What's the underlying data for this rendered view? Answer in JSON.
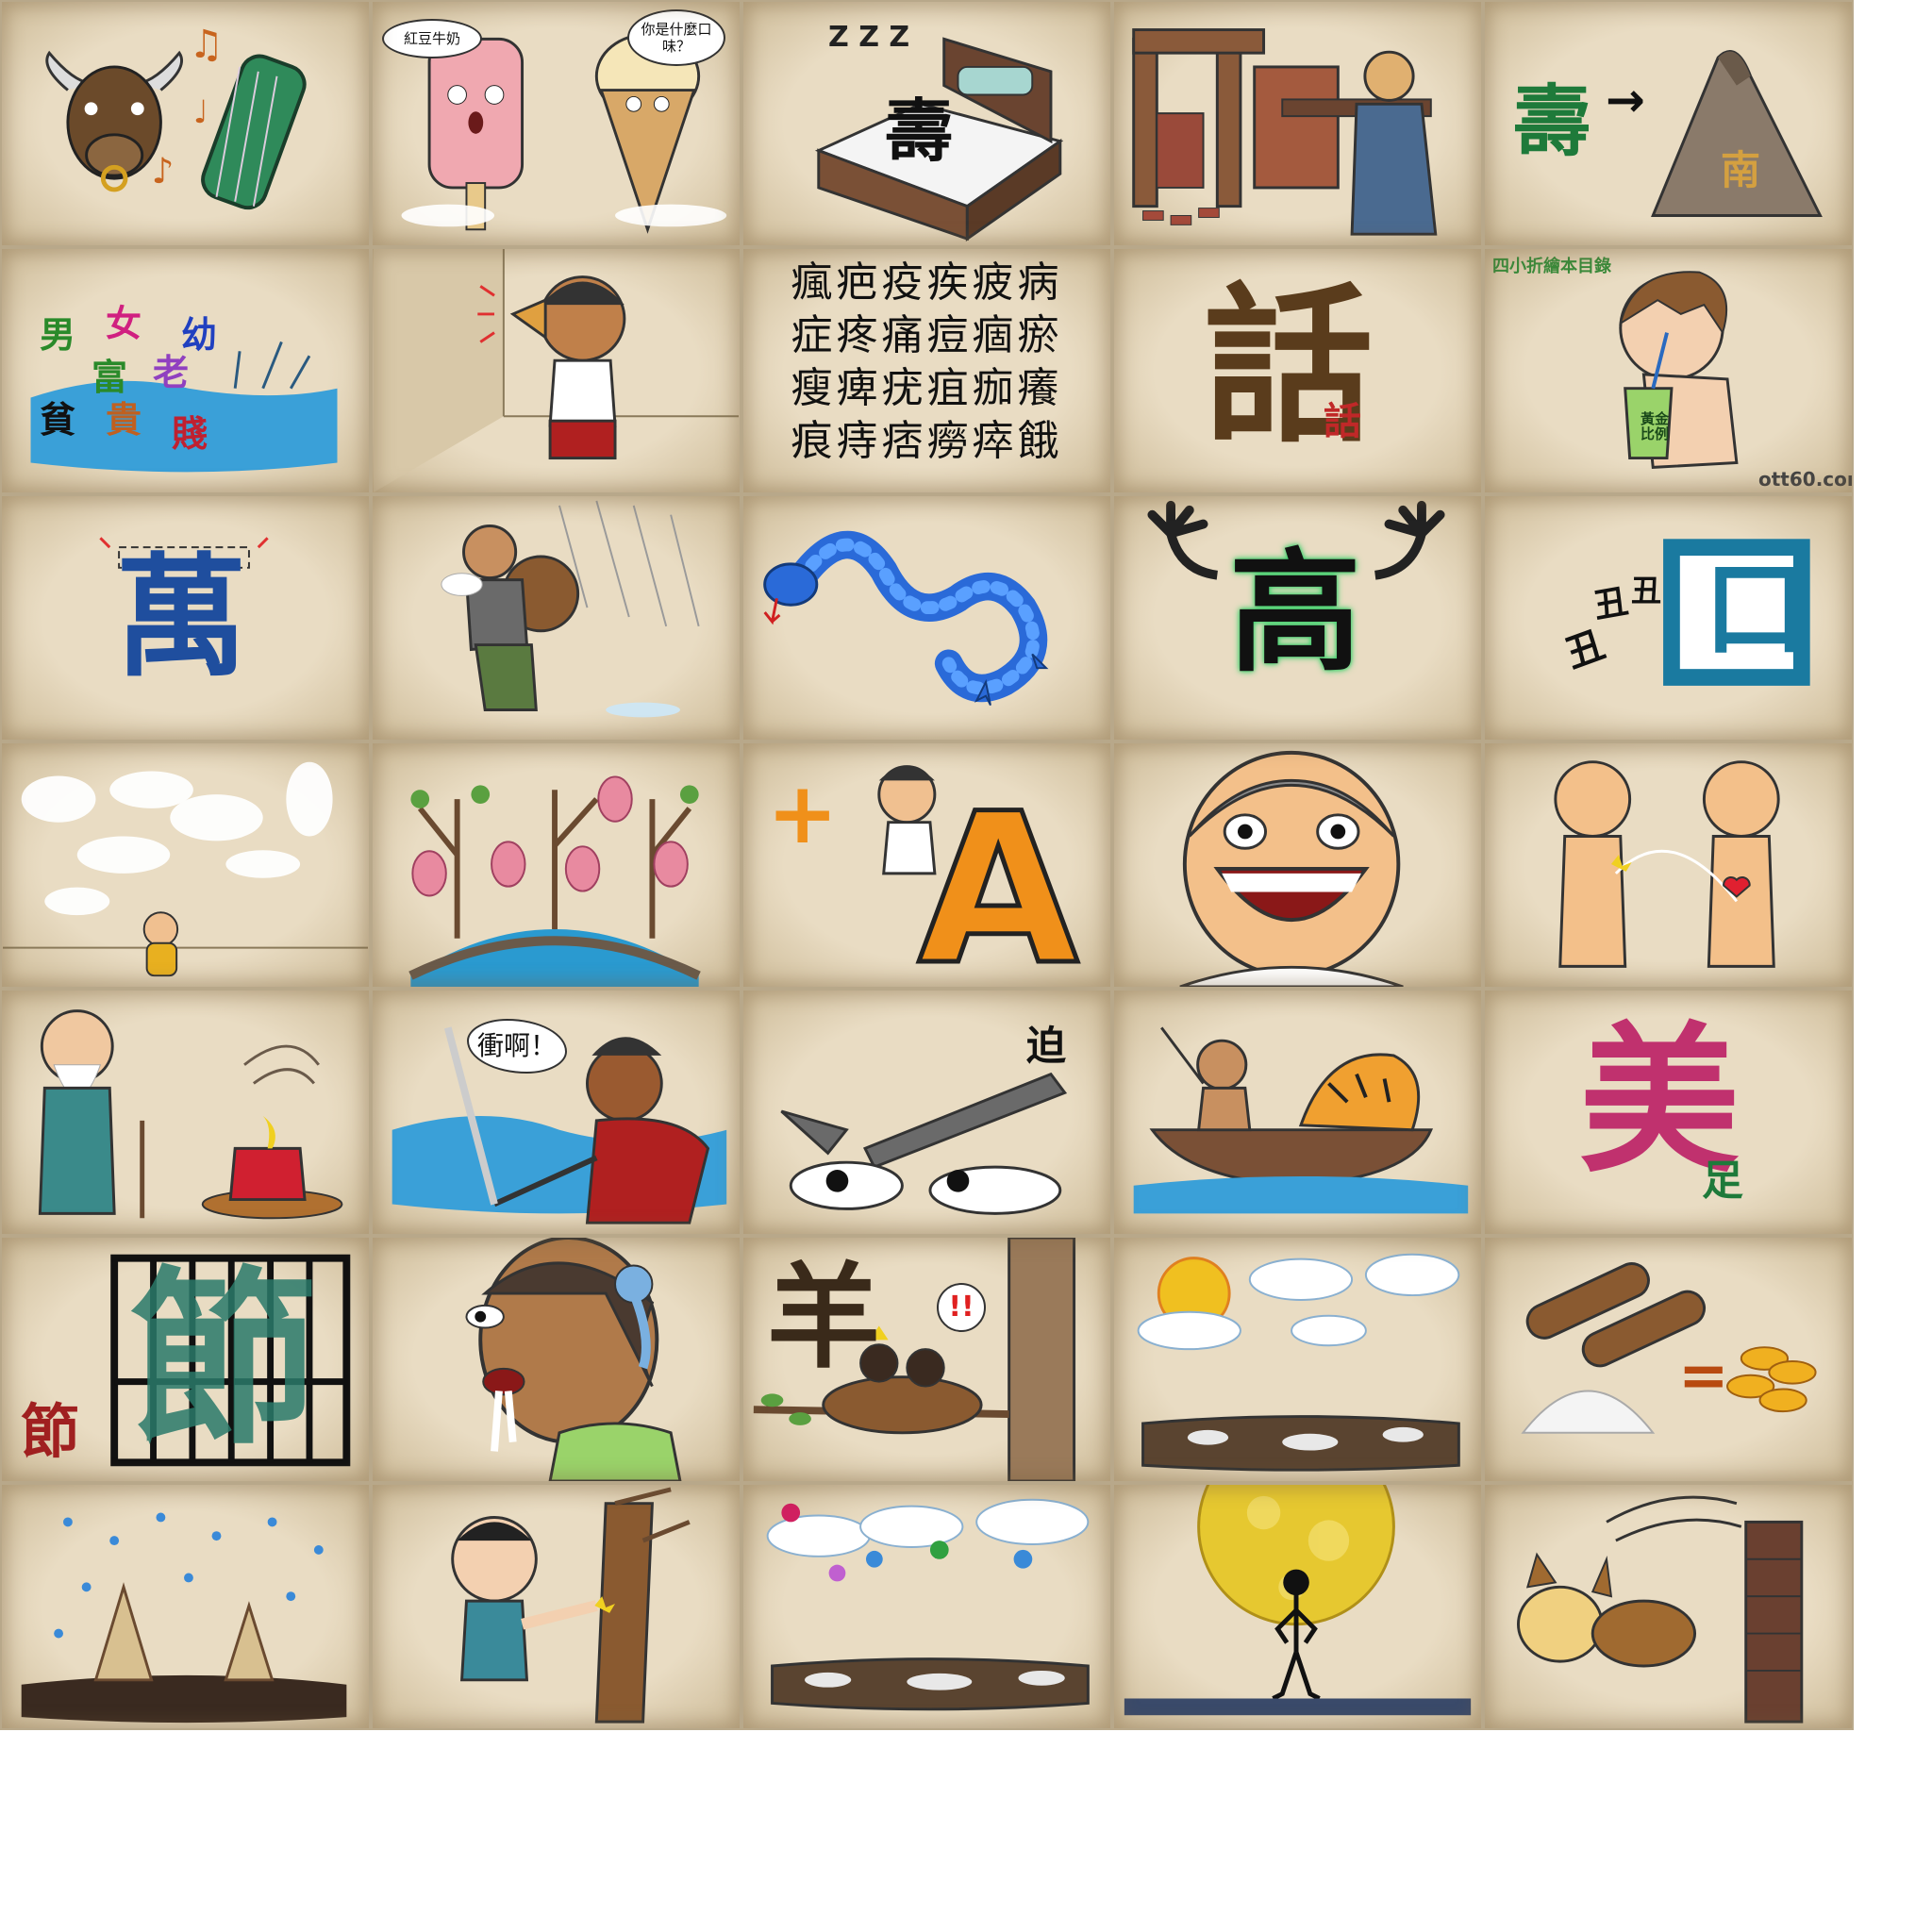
{
  "cards": {
    "c1": {
      "icon": "bull-and-zither-icon"
    },
    "c2": {
      "bubble_left": "紅豆牛奶",
      "bubble_right": "你是什麼口味？"
    },
    "c3": {
      "char": "壽",
      "sleep": "Z Z Z"
    },
    "c4": {
      "icon": "man-carrying-beam-icon"
    },
    "c5": {
      "left_char": "壽",
      "arrow": "→",
      "mountain_char": "南"
    },
    "c6": {
      "chars": [
        "男",
        "女",
        "幼",
        "富",
        "老",
        "貧",
        "貴",
        "賤"
      ]
    },
    "c7": {
      "icon": "man-listening-at-wall-icon"
    },
    "c8": {
      "rows": [
        "瘋疤疫疾疲病",
        "症疼痛痘痼瘀",
        "瘦痺疣疽痂癢",
        "痕痔痞癆瘁餓"
      ]
    },
    "c9": {
      "big": "話",
      "small": "話"
    },
    "c10": {
      "top_watermark": "四小折繪本目錄",
      "drink_label": "黃金比例",
      "bottom_watermark": "ott60.com"
    },
    "c11": {
      "char": "萬"
    },
    "c12": {
      "icon": "man-carrying-snails-in-rain-icon"
    },
    "c13": {
      "icon": "snake-dragon-icon"
    },
    "c14": {
      "char": "高"
    },
    "c15": {
      "small_char": "丑",
      "big_char": "口"
    },
    "c16": {
      "icon": "cloud-animals-icon"
    },
    "c17": {
      "icon": "peach-trees-bridge-icon"
    },
    "c18": {
      "plus": "+",
      "letter": "A"
    },
    "c19": {
      "icon": "laughing-face-icon"
    },
    "c20": {
      "icon": "two-figures-heart-icon"
    },
    "c21": {
      "icon": "old-man-candle-icon"
    },
    "c22": {
      "shout": "衝啊！"
    },
    "c23": {
      "char": "迫"
    },
    "c24": {
      "icon": "fisherman-tiger-boat-icon"
    },
    "c25": {
      "big": "美",
      "small": "足"
    },
    "c26": {
      "big": "節",
      "side": "節"
    },
    "c27": {
      "icon": "drooling-man-icon"
    },
    "c28": {
      "char": "羊",
      "exclaim": "!!"
    },
    "c29": {
      "icon": "sun-clouds-ground-icon"
    },
    "c30": {
      "equals": "="
    },
    "c31": {
      "icon": "bamboo-shoots-rain-icon"
    },
    "c32": {
      "icon": "boy-breaking-tree-icon"
    },
    "c33": {
      "icon": "flowers-clouds-icon"
    },
    "c34": {
      "icon": "moon-stickman-icon"
    },
    "c35": {
      "icon": "dog-hitting-wall-icon"
    }
  },
  "colors": {
    "card_bg": "#e9dcc3",
    "green_char": "#1e7a3a",
    "blue_char": "#1f4e9e",
    "magenta_char": "#c0316e",
    "brown_char": "#5a3c1c"
  }
}
